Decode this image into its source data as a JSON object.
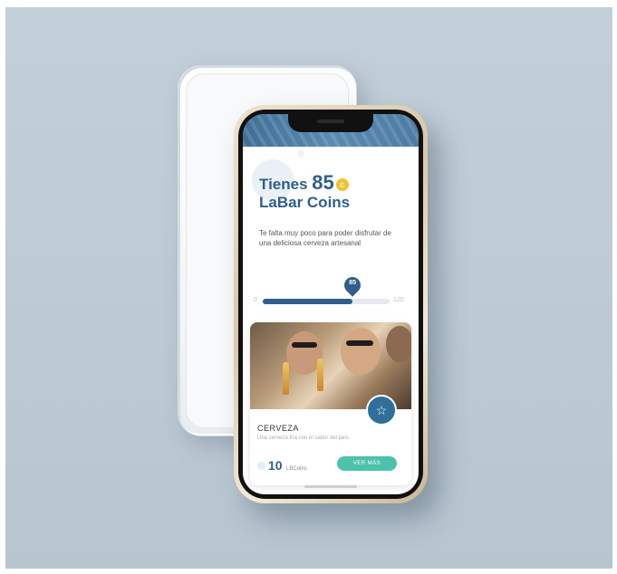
{
  "app": {
    "title_prefix": "Tienes",
    "coins_value": "85",
    "coin_symbol": "c",
    "title_suffix": "LaBar Coins",
    "description": "Te falta muy poco para poder disfrutar de una deliciosa cerveza artesanal",
    "progress": {
      "min_label": "0",
      "max_label": "120",
      "current_label": "85",
      "current": 85,
      "max": 120
    },
    "card": {
      "title": "CERVEZA",
      "description": "Una cerveza fría con el sabor del país",
      "price": "10",
      "price_unit": "LBCoins",
      "button_label": "VER MÁS",
      "favorite_icon": "star-icon"
    }
  },
  "colors": {
    "brand_blue": "#2f5f8a",
    "accent_teal": "#4cc2ad",
    "coin_yellow": "#f4c12b"
  }
}
